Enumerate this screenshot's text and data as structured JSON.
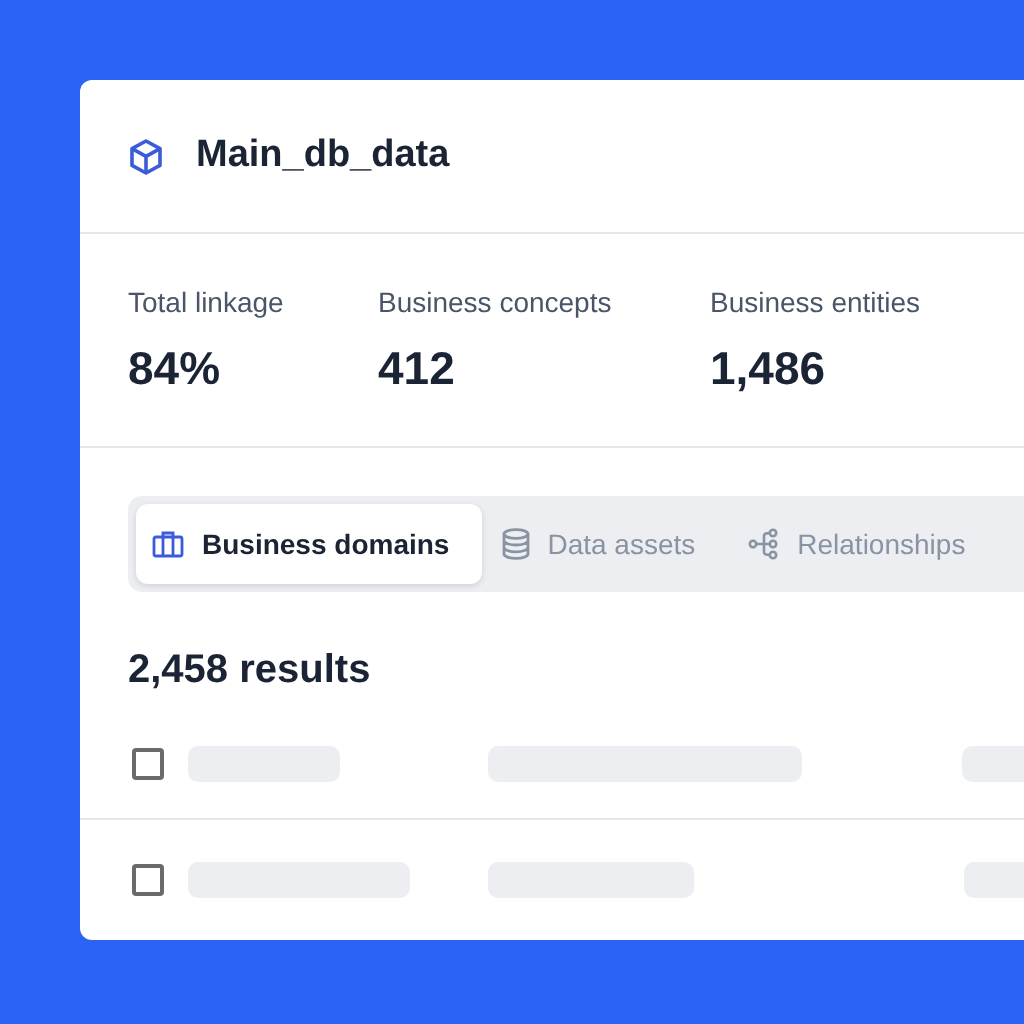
{
  "card": {
    "title": "Main_db_data"
  },
  "stats": [
    {
      "label": "Total linkage",
      "value": "84%"
    },
    {
      "label": "Business concepts",
      "value": "412"
    },
    {
      "label": "Business entities",
      "value": "1,486"
    }
  ],
  "tabs": [
    {
      "label": "Business domains",
      "kind": "domains",
      "selected": true
    },
    {
      "label": "Data assets",
      "kind": "assets",
      "selected": false
    },
    {
      "label": "Relationships",
      "kind": "relationships",
      "selected": false
    }
  ],
  "results": {
    "count": "2,458 results"
  },
  "rows": [
    {
      "checked": false
    },
    {
      "checked": false
    }
  ]
}
